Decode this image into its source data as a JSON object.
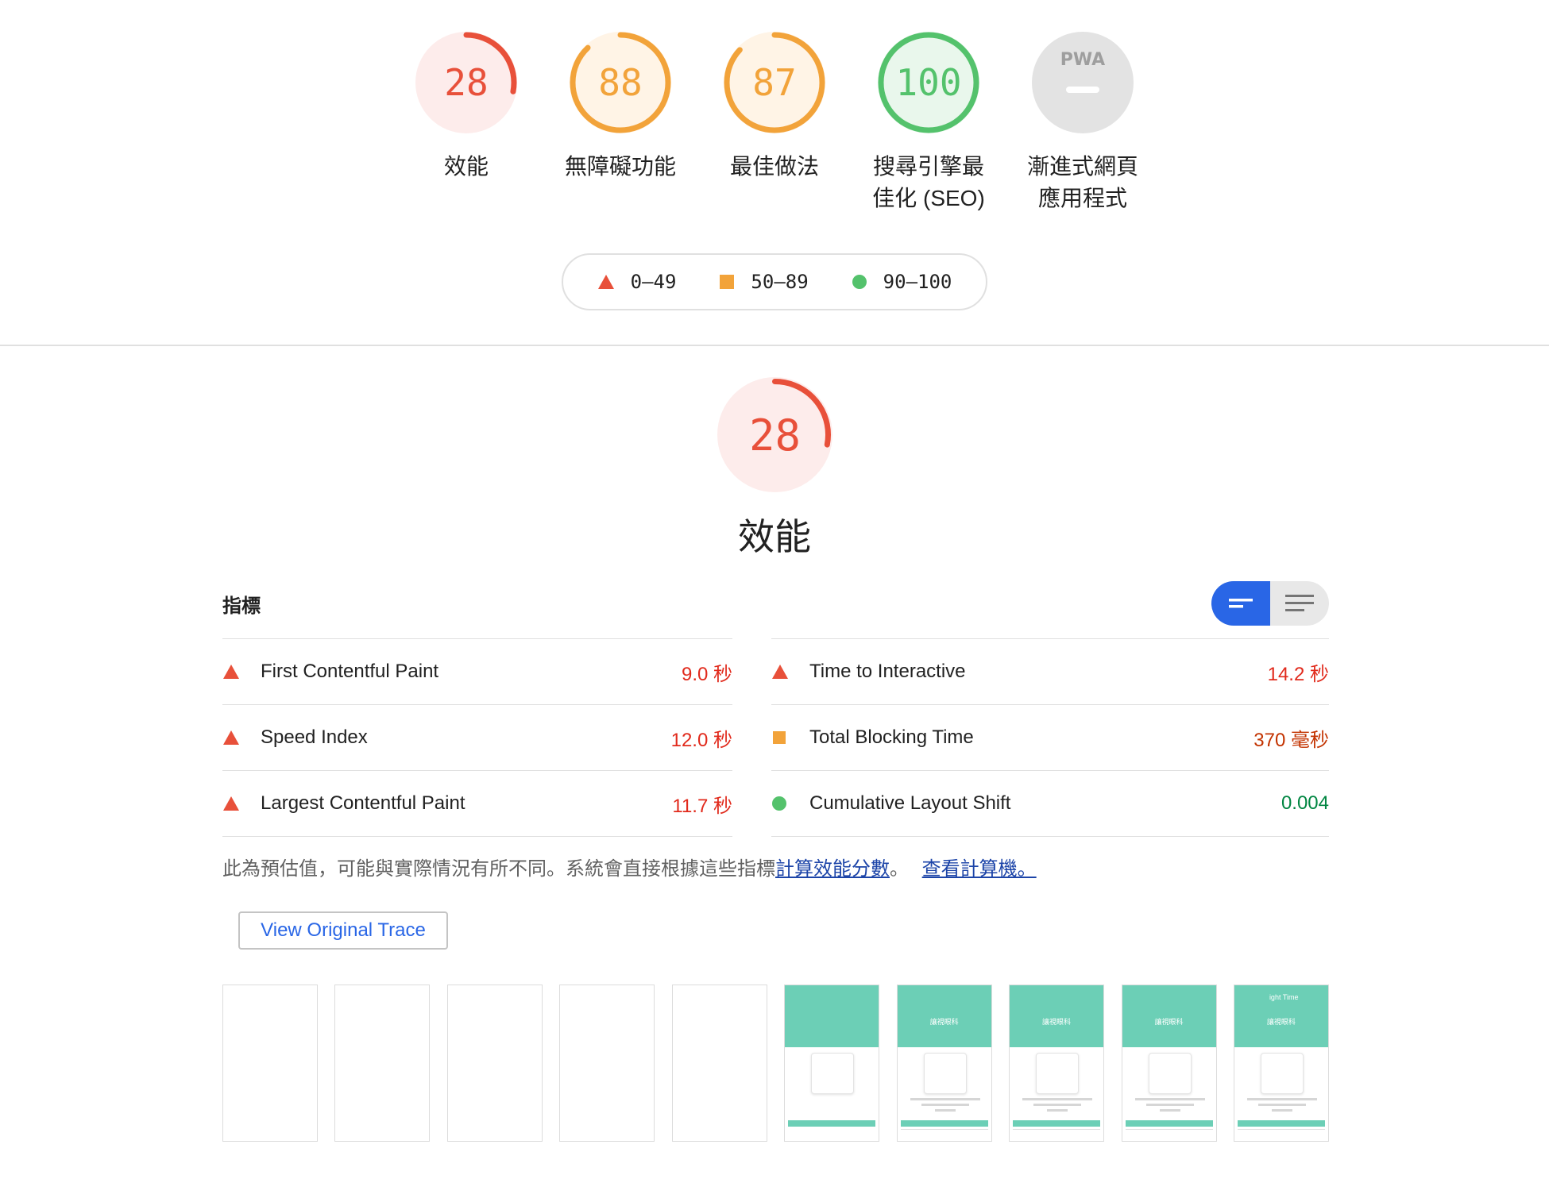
{
  "categories": [
    {
      "id": "performance",
      "score": "28",
      "fraction": 0.28,
      "label": "效能",
      "status": "fail",
      "color": "#e8503a",
      "bg": "#fdeceb",
      "text_color": "#e8503a"
    },
    {
      "id": "accessibility",
      "score": "88",
      "fraction": 0.88,
      "label": "無障礙功能",
      "status": "average",
      "color": "#f2a33a",
      "bg": "#fff4e6",
      "text_color": "#f2a33a"
    },
    {
      "id": "best-practices",
      "score": "87",
      "fraction": 0.87,
      "label": "最佳做法",
      "status": "average",
      "color": "#f2a33a",
      "bg": "#fff4e6",
      "text_color": "#f2a33a"
    },
    {
      "id": "seo",
      "score": "100",
      "fraction": 1.0,
      "label": "搜尋引擎最佳化 (SEO)",
      "status": "pass",
      "color": "#54c26c",
      "bg": "#e9f7ec",
      "text_color": "#54c26c"
    },
    {
      "id": "pwa",
      "score": "",
      "fraction": 0,
      "label": "漸進式網頁應用程式",
      "status": "na",
      "badge": "PWA",
      "color": "#c8c8c8",
      "bg": "#e3e3e3",
      "text_color": "#9e9e9e"
    }
  ],
  "legend": {
    "fail": "0–49",
    "average": "50–89",
    "pass": "90–100",
    "colors": {
      "fail": "#e8503a",
      "average": "#f2a33a",
      "pass": "#54c26c"
    }
  },
  "performance": {
    "score": "28",
    "fraction": 0.28,
    "title": "效能"
  },
  "metrics": {
    "title": "指標",
    "left": [
      {
        "name": "First Contentful Paint",
        "value": "9.0 秒",
        "status": "fail"
      },
      {
        "name": "Speed Index",
        "value": "12.0 秒",
        "status": "fail"
      },
      {
        "name": "Largest Contentful Paint",
        "value": "11.7 秒",
        "status": "fail"
      }
    ],
    "right": [
      {
        "name": "Time to Interactive",
        "value": "14.2 秒",
        "status": "fail"
      },
      {
        "name": "Total Blocking Time",
        "value": "370 毫秒",
        "status": "average"
      },
      {
        "name": "Cumulative Layout Shift",
        "value": "0.004",
        "status": "pass"
      }
    ]
  },
  "note": {
    "text": "此為預估值，可能與實際情況有所不同。系統會直接根據這些指標",
    "link1": "計算效能分數",
    "sep": "。",
    "link2": "查看計算機。"
  },
  "trace_button": "View Original Trace",
  "filmstrip": {
    "frames": [
      "blank",
      "blank",
      "blank",
      "blank",
      "blank",
      "loading",
      "content",
      "content",
      "content",
      "content"
    ],
    "hero_text": "讓視眼科",
    "logo_text": "ight Time"
  }
}
